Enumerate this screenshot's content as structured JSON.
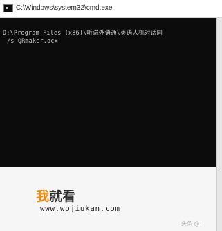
{
  "window": {
    "title": "C:\\Windows\\system32\\cmd.exe",
    "icon": "cmd-icon"
  },
  "console": {
    "lines": [
      "D:\\Program Files (x86)\\听说外语通\\英语人机对话同",
      "/s QRmaker.ocx"
    ]
  },
  "overlay": {
    "logo_accent": "我",
    "logo_rest": "就看",
    "url": "www.wojiukan.com",
    "watermark": "头条 @…"
  },
  "colors": {
    "console_bg": "#0c0c0c",
    "console_text": "#c8c8c8",
    "logo_accent": "#f08a0c"
  }
}
